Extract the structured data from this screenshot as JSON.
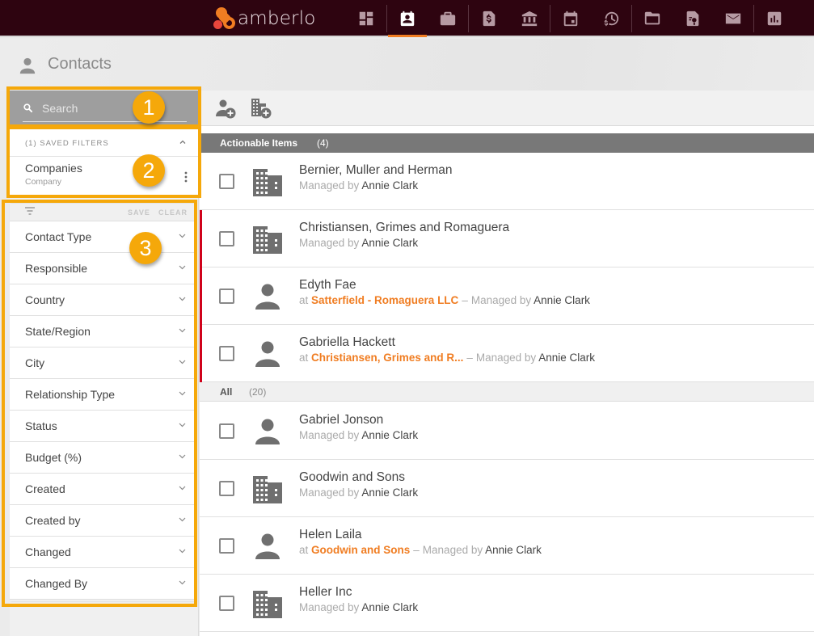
{
  "app": {
    "logo_text": "amberlo",
    "brand_color": "#f07d22",
    "topbar_color": "#2e0410"
  },
  "nav": [
    {
      "icon": "dashboard-icon",
      "active": false
    },
    {
      "icon": "contacts-icon",
      "active": true
    },
    {
      "icon": "briefcase-icon",
      "active": false
    },
    {
      "icon": "invoice-icon",
      "active": false
    },
    {
      "icon": "bank-icon",
      "active": false
    },
    {
      "icon": "calendar-icon",
      "active": false
    },
    {
      "icon": "time-billing-icon",
      "active": false
    },
    {
      "icon": "folder-icon",
      "active": false
    },
    {
      "icon": "certificate-document-icon",
      "active": false
    },
    {
      "icon": "mail-icon",
      "active": false
    },
    {
      "icon": "reports-icon",
      "active": false
    }
  ],
  "page": {
    "title": "Contacts",
    "icon": "person-icon"
  },
  "sidebar": {
    "search": {
      "placeholder": "Search",
      "value": ""
    },
    "saved_filters": {
      "title": "(1) SAVED FILTERS",
      "items": [
        {
          "name": "Companies",
          "sub": "Company"
        }
      ]
    },
    "filter_toolbar": {
      "save_label": "SAVE",
      "clear_label": "CLEAR"
    },
    "filters": [
      "Contact Type",
      "Responsible",
      "Country",
      "State/Region",
      "City",
      "Relationship Type",
      "Status",
      "Budget (%)",
      "Created",
      "Created by",
      "Changed",
      "Changed By"
    ]
  },
  "annotations": [
    "1",
    "2",
    "3"
  ],
  "toolbar": {
    "add_person_icon": "add-person-icon",
    "add_company_icon": "add-company-icon"
  },
  "groups": {
    "actionable": {
      "label": "Actionable Items",
      "count": "(4)"
    },
    "all": {
      "label": "All",
      "count": "(20)"
    }
  },
  "rows": {
    "actionable": [
      {
        "type": "company",
        "name": "Bernier, Muller and Herman",
        "org": "",
        "managed_label": "Managed by",
        "manager": "Annie Clark",
        "flag": false
      },
      {
        "type": "company",
        "name": "Christiansen, Grimes and Romaguera",
        "org": "",
        "managed_label": "Managed by",
        "manager": "Annie Clark",
        "flag": true
      },
      {
        "type": "person",
        "name": "Edyth Fae",
        "at_label": "at",
        "org": "Satterfield - Romaguera LLC",
        "managed_label": "Managed by",
        "manager": "Annie Clark",
        "flag": true
      },
      {
        "type": "person",
        "name": "Gabriella Hackett",
        "at_label": "at",
        "org": "Christiansen, Grimes and R...",
        "managed_label": "Managed by",
        "manager": "Annie Clark",
        "flag": true
      }
    ],
    "all": [
      {
        "type": "person",
        "name": "Gabriel Jonson",
        "org": "",
        "managed_label": "Managed by",
        "manager": "Annie Clark"
      },
      {
        "type": "company",
        "name": "Goodwin and Sons",
        "org": "",
        "managed_label": "Managed by",
        "manager": "Annie Clark"
      },
      {
        "type": "person",
        "name": "Helen Laila",
        "at_label": "at",
        "org": "Goodwin and Sons",
        "managed_label": "Managed by",
        "manager": "Annie Clark"
      },
      {
        "type": "company",
        "name": "Heller Inc",
        "org": "",
        "managed_label": "Managed by",
        "manager": "Annie Clark"
      }
    ]
  },
  "dash": "–"
}
